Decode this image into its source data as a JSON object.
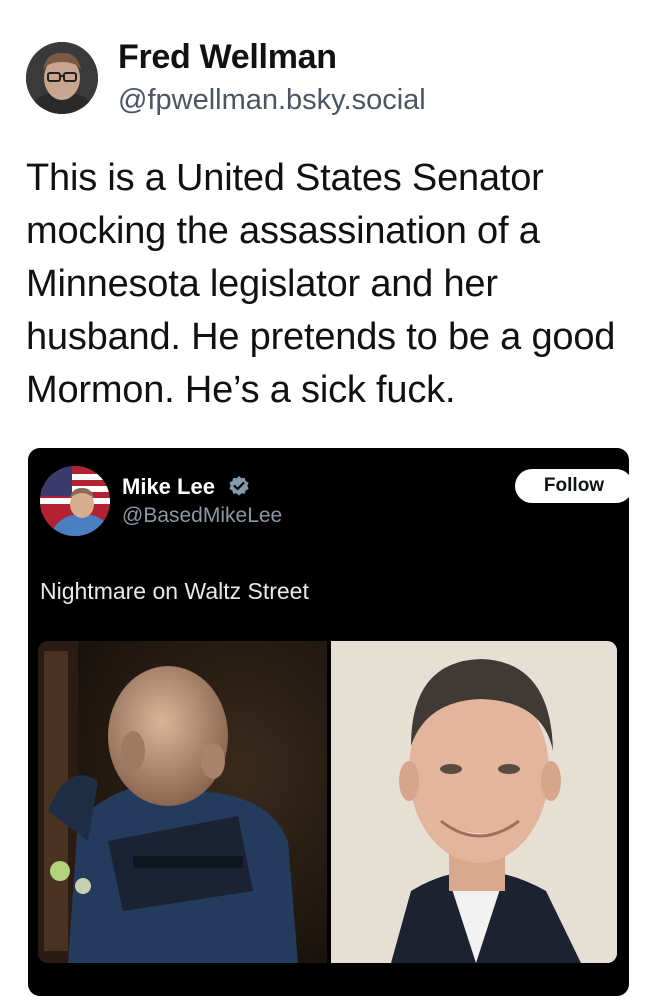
{
  "post": {
    "author_name": "Fred Wellman",
    "author_handle": "@fpwellman.bsky.social",
    "text": "This is a United States Senator mocking the assassination of a Minnesota legislator and her husband. He pretends to be a good Mormon. He’s a sick fuck."
  },
  "embed": {
    "author_name": "Mike Lee",
    "author_handle": "@BasedMikeLee",
    "follow_label": "Follow",
    "text": "Nightmare on Waltz Street",
    "verified_icon": "verified-badge-icon",
    "colors": {
      "background": "#000000",
      "name": "#ffffff",
      "handle": "#8b98a5",
      "follow_bg": "#ffffff"
    }
  }
}
